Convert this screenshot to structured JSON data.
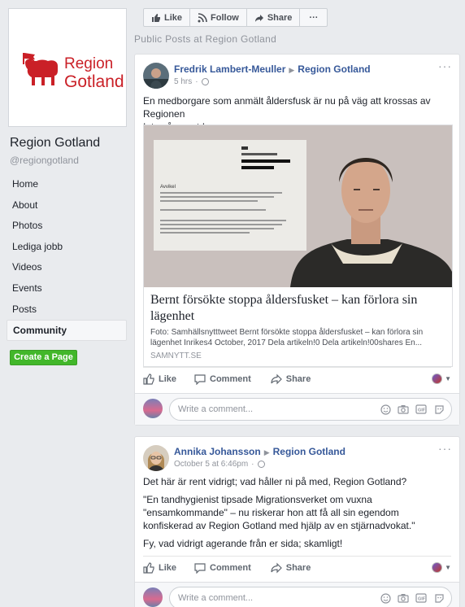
{
  "page": {
    "name": "Region Gotland",
    "handle": "@regiongotland",
    "logo_line1": "Region",
    "logo_line2": "Gotland"
  },
  "nav": [
    "Home",
    "About",
    "Photos",
    "Lediga jobb",
    "Videos",
    "Events",
    "Posts",
    "Community"
  ],
  "create_page": "Create a Page",
  "actionbar": {
    "like": "Like",
    "follow": "Follow",
    "share": "Share",
    "more": "···"
  },
  "section_title": "Public Posts at Region Gotland",
  "post1": {
    "author": "Fredrik Lambert-Meuller",
    "target": "Region Gotland",
    "time": "5 hrs",
    "text_line1": "En medborgare som anmält åldersfusk är nu på väg att krossas av Regionen",
    "text_line2": "Inte så smart !",
    "link_title": "Bernt försökte stoppa åldersfusket – kan förlora sin lägenhet",
    "link_desc": "Foto: Samhällsnytttweet Bernt försökte stoppa åldersfusket – kan förlora sin lägenhet Inrikes4 October, 2017 Dela artikeln!0 Dela artikeln!00shares En...",
    "link_source": "SAMNYTT.SE",
    "doc_heading": "Avvikel"
  },
  "post2": {
    "author": "Annika Johansson",
    "target": "Region Gotland",
    "time": "October 5 at 6:46pm",
    "p1": "Det här är rent vidrigt; vad håller ni på med, Region Gotland?",
    "p2": "\"En tandhygienist tipsade Migrationsverket om vuxna \"ensamkommande\" – nu riskerar hon att få all sin egendom konfiskerad av Region Gotland med hjälp av en stjärnadvokat.\"",
    "p3": "Fy, vad vidrigt agerande från er sida; skamligt!"
  },
  "actions": {
    "like": "Like",
    "comment": "Comment",
    "share": "Share"
  },
  "comment_placeholder": "Write a comment...",
  "colors": {
    "link": "#365899",
    "green": "#42b72a",
    "bg": "#e9ebee",
    "logo_red": "#ca2027"
  }
}
